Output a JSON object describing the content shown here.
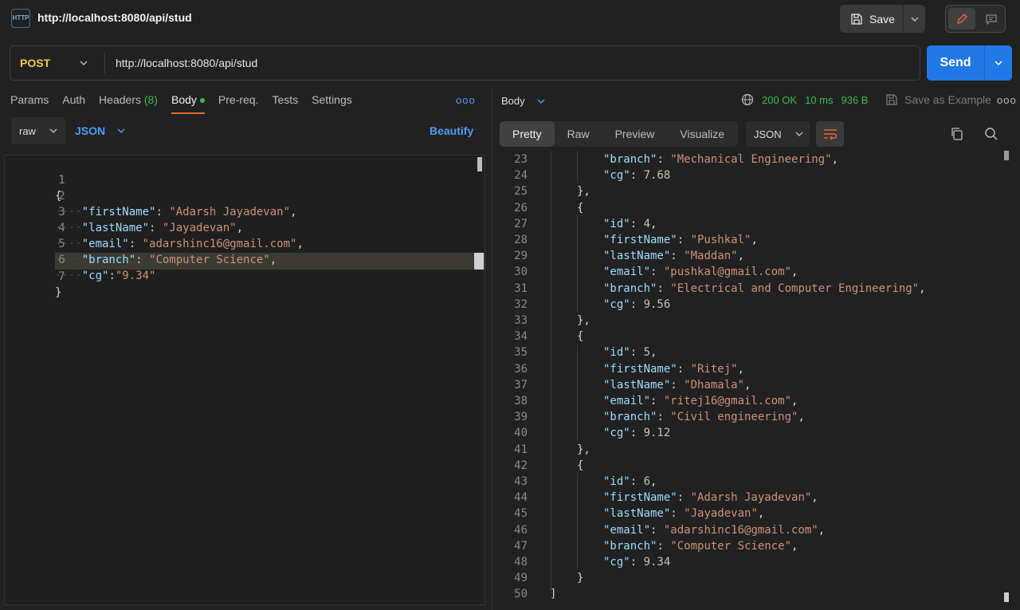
{
  "header": {
    "http_icon_text": "HTTP",
    "tab_title": "http://localhost:8080/api/stud",
    "save_label": "Save"
  },
  "url_bar": {
    "method": "POST",
    "url": "http://localhost:8080/api/stud",
    "send_label": "Send"
  },
  "request_tabs": {
    "params": "Params",
    "auth": "Auth",
    "headers": "Headers",
    "headers_count": "(8)",
    "body": "Body",
    "prereq": "Pre-req.",
    "tests": "Tests",
    "settings": "Settings"
  },
  "body_options": {
    "mode": "raw",
    "format": "JSON",
    "beautify": "Beautify"
  },
  "request_body": {
    "lines": [
      {
        "n": "1"
      },
      {
        "n": "2"
      },
      {
        "n": "3"
      },
      {
        "n": "4"
      },
      {
        "n": "5"
      },
      {
        "n": "6"
      },
      {
        "n": "7"
      }
    ],
    "open_brace": "{",
    "close_brace": "}",
    "first_name_key": "\"firstName\"",
    "first_name_val": "\"Adarsh Jayadevan\"",
    "last_name_key": "\"lastName\"",
    "last_name_val": "\"Jayadevan\"",
    "email_key": "\"email\"",
    "email_val": "\"adarshinc16@gmail.com\"",
    "branch_key": "\"branch\"",
    "branch_val": "\"Computer Science\"",
    "cg_key": "\"cg\"",
    "cg_val": "\"9.34\""
  },
  "response_header": {
    "body_label": "Body",
    "status": "200 OK",
    "time": "10 ms",
    "size": "936 B",
    "save_example": "Save as Example"
  },
  "response_tabs": {
    "pretty": "Pretty",
    "raw": "Raw",
    "preview": "Preview",
    "visualize": "Visualize",
    "format": "JSON"
  },
  "response_lines": [
    {
      "n": "23",
      "indent": 2,
      "k": "\"branch\"",
      "v": "\"Mechanical Engineering\"",
      "vt": "str",
      "trail": ","
    },
    {
      "n": "24",
      "indent": 2,
      "k": "\"cg\"",
      "v": "7.68",
      "vt": "num",
      "trail": ""
    },
    {
      "n": "25",
      "indent": 1,
      "p": "},"
    },
    {
      "n": "26",
      "indent": 1,
      "p": "{"
    },
    {
      "n": "27",
      "indent": 2,
      "k": "\"id\"",
      "v": "4",
      "vt": "num",
      "trail": ","
    },
    {
      "n": "28",
      "indent": 2,
      "k": "\"firstName\"",
      "v": "\"Pushkal\"",
      "vt": "str",
      "trail": ","
    },
    {
      "n": "29",
      "indent": 2,
      "k": "\"lastName\"",
      "v": "\"Maddan\"",
      "vt": "str",
      "trail": ","
    },
    {
      "n": "30",
      "indent": 2,
      "k": "\"email\"",
      "v": "\"pushkal@gmail.com\"",
      "vt": "str",
      "trail": ","
    },
    {
      "n": "31",
      "indent": 2,
      "k": "\"branch\"",
      "v": "\"Electrical and Computer Engineering\"",
      "vt": "str",
      "trail": ","
    },
    {
      "n": "32",
      "indent": 2,
      "k": "\"cg\"",
      "v": "9.56",
      "vt": "num",
      "trail": ""
    },
    {
      "n": "33",
      "indent": 1,
      "p": "},"
    },
    {
      "n": "34",
      "indent": 1,
      "p": "{"
    },
    {
      "n": "35",
      "indent": 2,
      "k": "\"id\"",
      "v": "5",
      "vt": "num",
      "trail": ","
    },
    {
      "n": "36",
      "indent": 2,
      "k": "\"firstName\"",
      "v": "\"Ritej\"",
      "vt": "str",
      "trail": ","
    },
    {
      "n": "37",
      "indent": 2,
      "k": "\"lastName\"",
      "v": "\"Dhamala\"",
      "vt": "str",
      "trail": ","
    },
    {
      "n": "38",
      "indent": 2,
      "k": "\"email\"",
      "v": "\"ritej16@gmail.com\"",
      "vt": "str",
      "trail": ","
    },
    {
      "n": "39",
      "indent": 2,
      "k": "\"branch\"",
      "v": "\"Civil engineering\"",
      "vt": "str",
      "trail": ","
    },
    {
      "n": "40",
      "indent": 2,
      "k": "\"cg\"",
      "v": "9.12",
      "vt": "num",
      "trail": ""
    },
    {
      "n": "41",
      "indent": 1,
      "p": "},"
    },
    {
      "n": "42",
      "indent": 1,
      "p": "{"
    },
    {
      "n": "43",
      "indent": 2,
      "k": "\"id\"",
      "v": "6",
      "vt": "num",
      "trail": ","
    },
    {
      "n": "44",
      "indent": 2,
      "k": "\"firstName\"",
      "v": "\"Adarsh Jayadevan\"",
      "vt": "str",
      "trail": ","
    },
    {
      "n": "45",
      "indent": 2,
      "k": "\"lastName\"",
      "v": "\"Jayadevan\"",
      "vt": "str",
      "trail": ","
    },
    {
      "n": "46",
      "indent": 2,
      "k": "\"email\"",
      "v": "\"adarshinc16@gmail.com\"",
      "vt": "str",
      "trail": ","
    },
    {
      "n": "47",
      "indent": 2,
      "k": "\"branch\"",
      "v": "\"Computer Science\"",
      "vt": "str",
      "trail": ","
    },
    {
      "n": "48",
      "indent": 2,
      "k": "\"cg\"",
      "v": "9.34",
      "vt": "num",
      "trail": ""
    },
    {
      "n": "49",
      "indent": 1,
      "p": "}"
    },
    {
      "n": "50",
      "indent": 0,
      "p": "]"
    }
  ],
  "colors": {
    "accent": "#2079e6",
    "method": "#f5c84b",
    "status_ok": "#3fb950",
    "tab_underline": "#e66a38"
  }
}
